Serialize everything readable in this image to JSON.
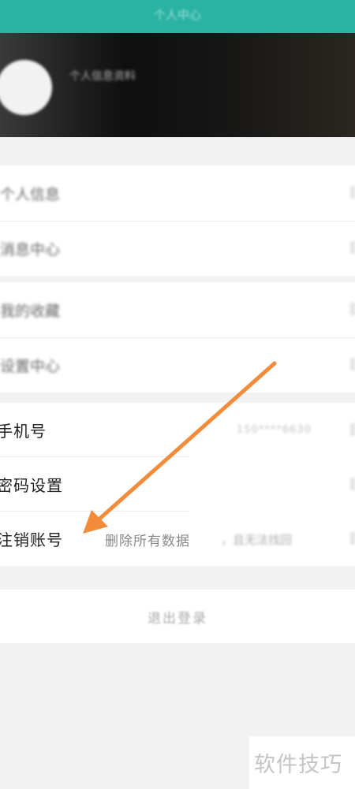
{
  "header": {
    "title": "个人中心"
  },
  "profile": {
    "name": "个人信息资料"
  },
  "group1": {
    "items": [
      {
        "label": "个人信息"
      },
      {
        "label": "消息中心"
      }
    ]
  },
  "group2": {
    "items": [
      {
        "label": "我的收藏"
      },
      {
        "label": "设置中心"
      }
    ]
  },
  "account": {
    "phone_label": "手机号",
    "phone_value": "150****6630",
    "password_label": "密码设置",
    "delete_label": "注销账号",
    "delete_hint": "删除所有数据",
    "delete_hint_tail": "，且无法找回"
  },
  "logout_label": "退出登录",
  "watermark": "软件技巧",
  "colors": {
    "header": "#2ab3a3",
    "arrow": "#f28b3a"
  }
}
